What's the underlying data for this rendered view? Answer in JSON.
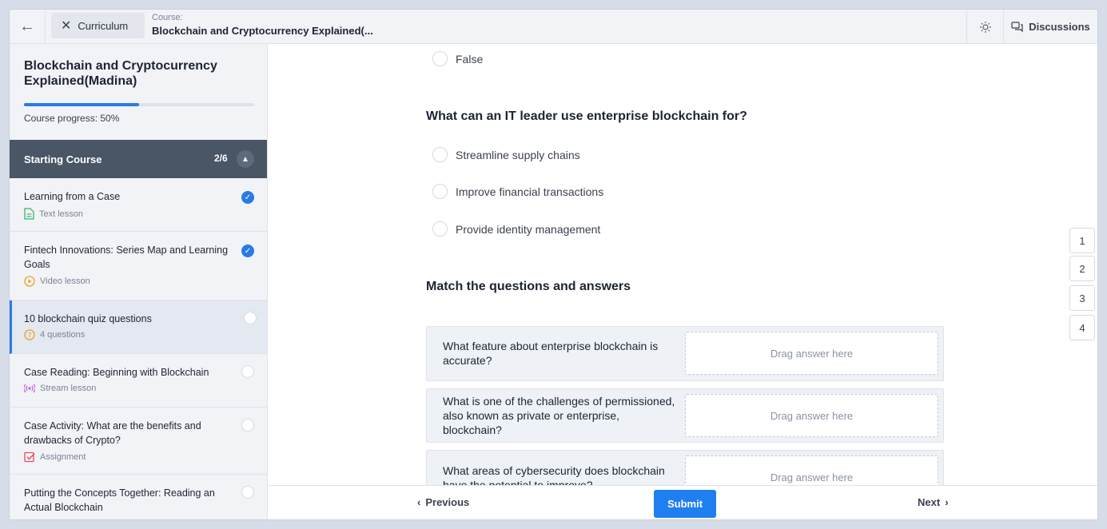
{
  "header": {
    "back_icon": "arrow-left-icon",
    "curriculum_label": "Curriculum",
    "course_label": "Course:",
    "course_title": "Blockchain and Cryptocurrency Explained(...",
    "theme_icon": "sun-icon",
    "discussions_label": "Discussions"
  },
  "sidebar": {
    "title": "Blockchain and Cryptocurrency Explained(Madina)",
    "progress_text": "Course progress: 50%",
    "progress_value": 0.5,
    "section": {
      "title": "Starting Course",
      "count": "2/6"
    },
    "lessons": [
      {
        "title": "Learning from a Case",
        "type": "Text lesson",
        "icon": "document-icon",
        "icon_color": "#3fb56b",
        "done": true
      },
      {
        "title": "Fintech Innovations: Series Map and Learning Goals",
        "type": "Video lesson",
        "icon": "play-icon",
        "icon_color": "#f0a020",
        "done": true
      },
      {
        "title": "10 blockchain quiz questions",
        "type": "4 questions",
        "icon": "question-icon",
        "icon_color": "#f0a020",
        "done": false,
        "active": true
      },
      {
        "title": "Case Reading: Beginning with Blockchain",
        "type": "Stream lesson",
        "icon": "stream-icon",
        "icon_color": "#c45ae0",
        "done": false
      },
      {
        "title": "Case Activity: What are the benefits and drawbacks of Crypto?",
        "type": "Assignment",
        "icon": "assignment-icon",
        "icon_color": "#ea4a5a",
        "done": false
      },
      {
        "title": "Putting the Concepts Together: Reading an Actual Blockchain",
        "type": "",
        "icon": "",
        "done": false
      }
    ]
  },
  "quiz": {
    "prev_options": [
      "False"
    ],
    "question_2": {
      "text": "What can an IT leader use enterprise blockchain for?",
      "options": [
        "Streamline supply chains",
        "Improve financial transactions",
        "Provide identity management"
      ]
    },
    "question_3": {
      "text": "Match the questions and answers",
      "rows": [
        {
          "q": "What feature about enterprise blockchain is accurate?",
          "drop": "Drag answer here"
        },
        {
          "q": "What is one of the challenges of permissioned, also known as private or enterprise, blockchain?",
          "drop": "Drag answer here"
        },
        {
          "q": "What areas of cybersecurity does blockchain have the potential to improve?",
          "drop": "Drag answer here"
        }
      ]
    },
    "nav": [
      "1",
      "2",
      "3",
      "4"
    ]
  },
  "footer": {
    "previous": "Previous",
    "submit": "Submit",
    "next": "Next"
  },
  "colors": {
    "accent": "#1f7ef0",
    "section_bg": "#4a5565",
    "sidebar_bg": "#f1f3f7"
  }
}
